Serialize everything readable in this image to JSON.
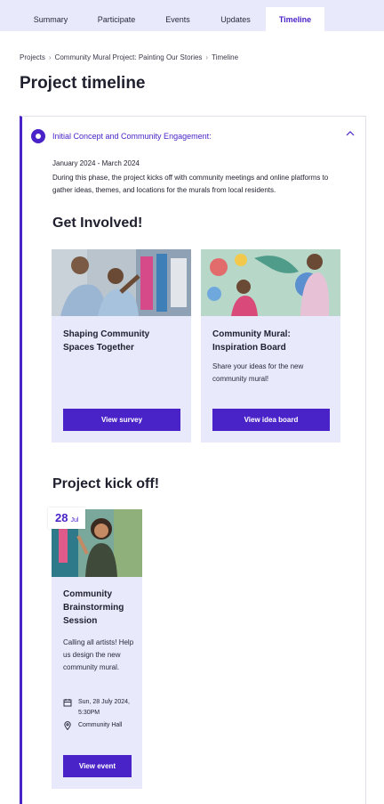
{
  "tabs": [
    {
      "label": "Summary"
    },
    {
      "label": "Participate"
    },
    {
      "label": "Events"
    },
    {
      "label": "Updates"
    },
    {
      "label": "Timeline"
    }
  ],
  "breadcrumb": {
    "items": [
      "Projects",
      "Community Mural Project: Painting Our Stories",
      "Timeline"
    ]
  },
  "page_title": "Project timeline",
  "phase": {
    "title": "Initial Concept and Community Engagement:",
    "dates": "January 2024 - March 2024",
    "description": "During this phase, the project kicks off with community meetings and online platforms to gather ideas, themes, and locations for the murals from local residents."
  },
  "get_involved": {
    "heading": "Get Involved!",
    "cards": [
      {
        "title": "Shaping Community Spaces Together",
        "text": "",
        "button": "View survey"
      },
      {
        "title": "Community Mural: Inspiration Board",
        "text": "Share your ideas for the new community mural!",
        "button": "View idea board"
      }
    ]
  },
  "kickoff": {
    "heading": "Project kick off!",
    "event": {
      "day": "28",
      "month": "Jul",
      "title": "Community Brainstorming Session",
      "text": "Calling all artists! Help us design the new community mural.",
      "datetime": "Sun, 28 July 2024, 5:30PM",
      "location": "Community Hall",
      "button": "View event"
    }
  },
  "colors": {
    "accent": "#4a23c8",
    "tab_bar": "#e8e9fb",
    "card_bg": "#e8e9fb"
  }
}
